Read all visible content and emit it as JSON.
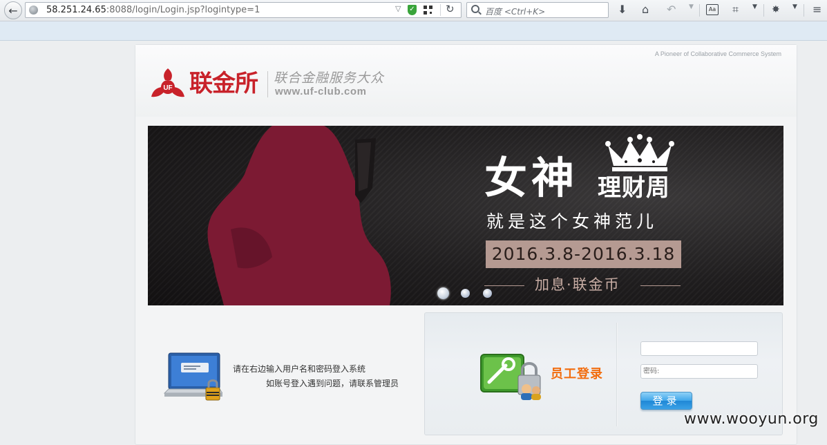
{
  "browser": {
    "url_host": "58.251.24.65",
    "url_rest": ":8088/login/Login.jsp?logintype=1",
    "search_placeholder": "百度 <Ctrl+K>",
    "reader_label": "Aa"
  },
  "header": {
    "tagline": "A Pioneer of Collaborative Commerce System",
    "logo_cn": "联金所",
    "logo_slogan": "联合金融服务大众",
    "logo_url": "www.uf-club.com"
  },
  "banner": {
    "title": "女神",
    "subtitle": "理财周",
    "slogan": "就是这个女神范儿",
    "date_range": "2016.3.8-2016.3.18",
    "footnote": "加息·联金币",
    "active_slide": 1,
    "slide_count": 3,
    "colors": {
      "figure": "#7c1a33",
      "accent": "#b59a92"
    }
  },
  "hint": {
    "line1": "请在右边输入用户名和密码登入系统",
    "line2": "如账号登入遇到问题，请联系管理员"
  },
  "login": {
    "title": "员工登录",
    "username_value": "",
    "password_placeholder": "密码:",
    "submit_label": "登录",
    "title_color": "#f26c0d"
  },
  "watermark": "www.wooyun.org"
}
